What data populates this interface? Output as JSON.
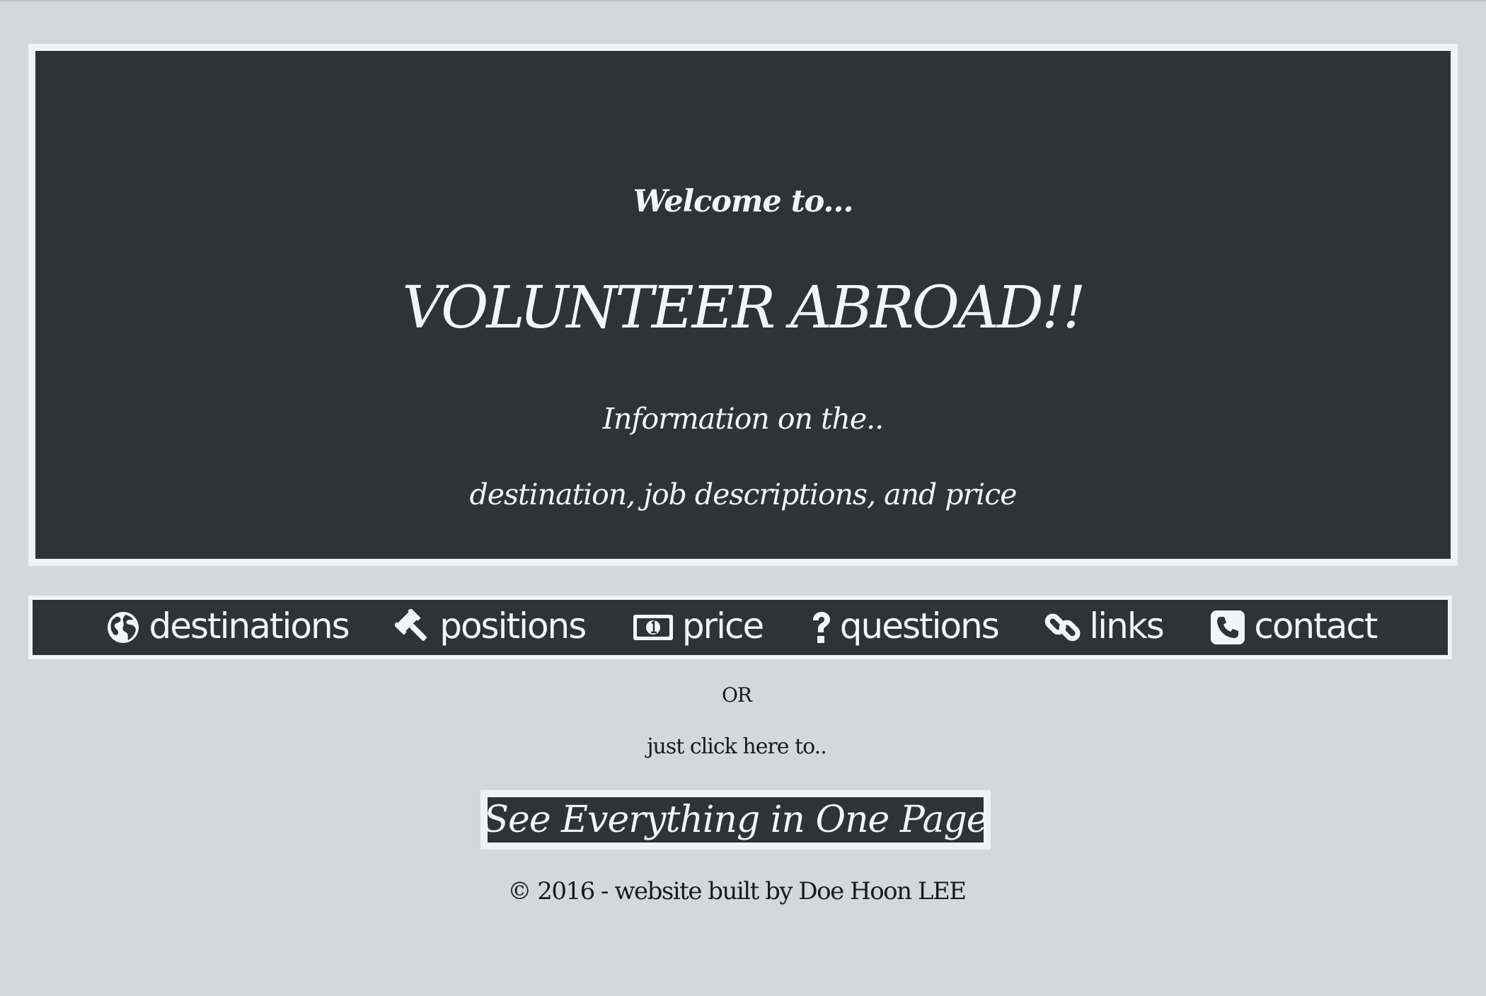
{
  "hero": {
    "welcome": "Welcome to...",
    "title": "VOLUNTEER ABROAD!!",
    "info": "Information on the..",
    "details": "destination, job descriptions, and price"
  },
  "nav": {
    "items": [
      {
        "label": "destinations",
        "icon": "globe-icon"
      },
      {
        "label": "positions",
        "icon": "gavel-icon"
      },
      {
        "label": "price",
        "icon": "money-icon"
      },
      {
        "label": "questions",
        "icon": "question-icon"
      },
      {
        "label": "links",
        "icon": "link-icon"
      },
      {
        "label": "contact",
        "icon": "phone-icon"
      }
    ]
  },
  "or_text": "OR",
  "click_text": "just click here to..",
  "see_all_label": "See Everything in One Page",
  "footer": "© 2016 - website built by Doe Hoon LEE",
  "colors": {
    "page_background": "#d5d8db",
    "panel_background": "#303336",
    "panel_border": "#eef3f8",
    "panel_text": "#f2f5f8"
  }
}
